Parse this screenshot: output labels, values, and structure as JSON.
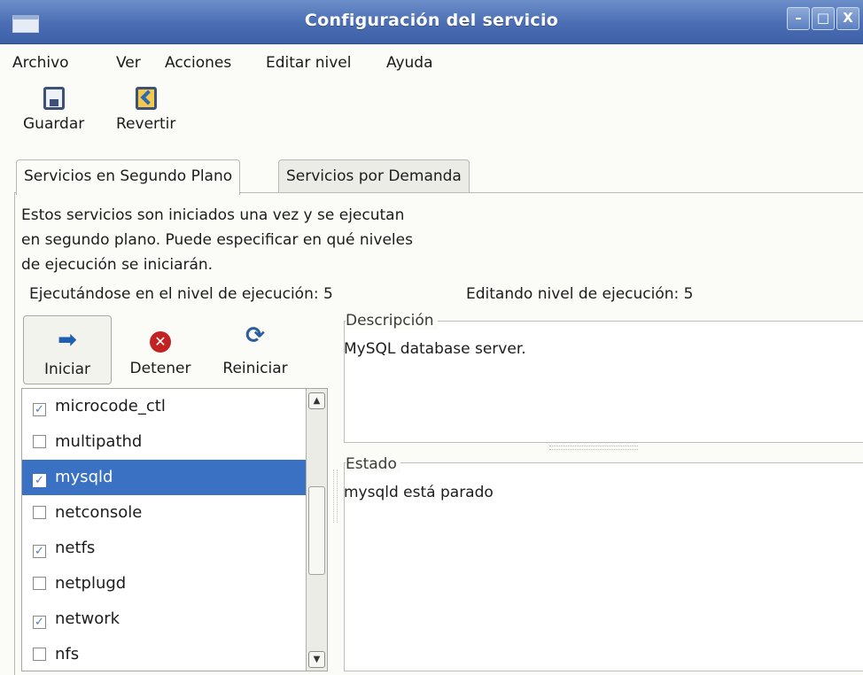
{
  "window": {
    "title": "Configuración del servicio",
    "buttons": {
      "minimize": "–",
      "maximize": "□",
      "close": "X"
    }
  },
  "menu": [
    "Archivo",
    "Ver",
    "Acciones",
    "Editar nivel",
    "Ayuda"
  ],
  "toolbar": {
    "save_label": "Guardar",
    "revert_label": "Revertir"
  },
  "tabs": [
    "Servicios en Segundo Plano",
    "Servicios por Demanda"
  ],
  "description_lines": [
    "Estos servicios son iniciados una vez y se ejecutan",
    "en segundo plano. Puede especificar en qué niveles",
    "de ejecución se iniciarán."
  ],
  "runlevel": {
    "running": "Ejecutándose en el nivel de ejecución: 5",
    "editing": "Editando nivel de ejecución: 5"
  },
  "actions": {
    "start": "Iniciar",
    "stop": "Detener",
    "restart": "Reiniciar"
  },
  "services": [
    {
      "name": "microcode_ctl",
      "checked": true,
      "selected": false
    },
    {
      "name": "multipathd",
      "checked": false,
      "selected": false
    },
    {
      "name": "mysqld",
      "checked": true,
      "selected": true
    },
    {
      "name": "netconsole",
      "checked": false,
      "selected": false
    },
    {
      "name": "netfs",
      "checked": true,
      "selected": false
    },
    {
      "name": "netplugd",
      "checked": false,
      "selected": false
    },
    {
      "name": "network",
      "checked": true,
      "selected": false
    },
    {
      "name": "nfs",
      "checked": false,
      "selected": false
    }
  ],
  "details": {
    "description_label": "Descripción",
    "description_text": "MySQL database server.",
    "status_label": "Estado",
    "status_text": "mysqld está parado"
  },
  "colors": {
    "titlebar": "#4a6db3",
    "selection": "#3a71c2",
    "check": "#4a7bc7"
  }
}
